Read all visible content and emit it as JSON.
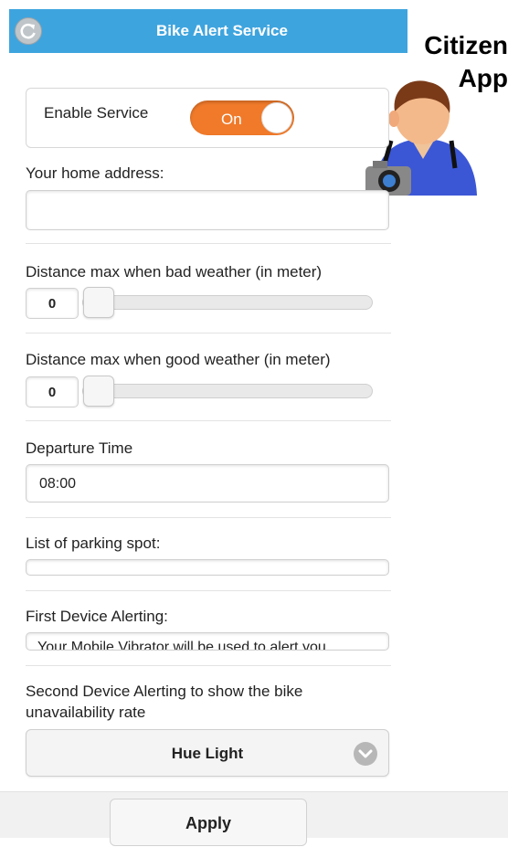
{
  "header": {
    "title": "Bike Alert Service"
  },
  "badge": {
    "line1": "Citizen",
    "line2": "App"
  },
  "enable_service": {
    "label": "Enable Service",
    "toggle_label": "On",
    "enabled": true
  },
  "home_address": {
    "label": "Your home address:",
    "value": ""
  },
  "bad_weather": {
    "label": "Distance max when bad weather (in meter)",
    "value": "0",
    "slider_fraction": 0
  },
  "good_weather": {
    "label": "Distance max when good weather (in meter)",
    "value": "0",
    "slider_fraction": 0
  },
  "departure": {
    "label": "Departure Time",
    "value": "08:00"
  },
  "parking": {
    "label": "List of parking spot:",
    "value": ""
  },
  "first_device": {
    "label": "First Device Alerting:",
    "value": "Your Mobile Vibrator will be used to alert you"
  },
  "second_device": {
    "label_line1": "Second Device Alerting to show the bike",
    "label_line2": "unavailability rate",
    "selected": "Hue Light"
  },
  "apply_label": "Apply",
  "colors": {
    "header": "#3ea4de",
    "toggle_on": "#f07a2a"
  }
}
